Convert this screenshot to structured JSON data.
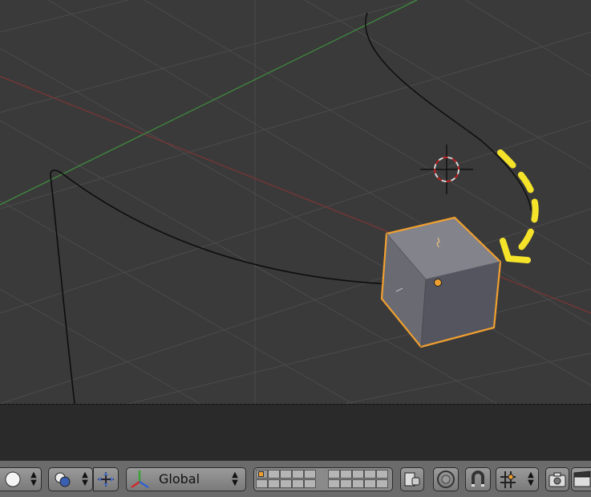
{
  "viewport": {
    "name": "3D View",
    "colors": {
      "background": "#3a3a3a",
      "grid": "#4b4b4b",
      "x_axis": "#7a3535",
      "y_axis": "#3f8a3f",
      "selection_outline": "#f0a030",
      "annotation_arrow": "#f5e32a",
      "curve": "#0d0d0d"
    },
    "objects": [
      {
        "name": "cube",
        "state": "selected"
      },
      {
        "name": "bezier-curve",
        "state": "unselected"
      },
      {
        "name": "3d-cursor"
      }
    ]
  },
  "header": {
    "viewport_shading_icon": "solid-sphere-icon",
    "pivot_icon": "pivot-point-icon",
    "manipulator_icon": "manipulator-icon",
    "orientation_icon": "transform-orientation-icon",
    "orientation_value": "Global",
    "layers_icon": "layers-icon",
    "lock_camera_icon": "lock-icon",
    "proportional_icon": "proportional-edit-icon",
    "snap_icon": "magnet-icon",
    "snap_element_icon": "snap-element-icon",
    "render_icon": "camera-icon",
    "animation_render_icon": "clapper-icon"
  }
}
